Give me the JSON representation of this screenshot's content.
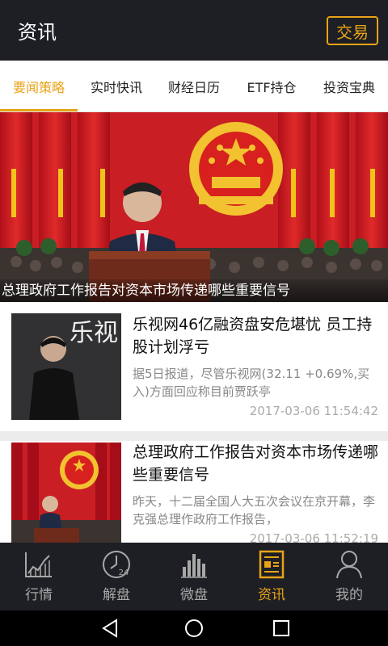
{
  "header": {
    "title": "资讯",
    "trade_button": "交易"
  },
  "tabs": [
    {
      "label": "要闻策略",
      "active": true
    },
    {
      "label": "实时快讯",
      "active": false
    },
    {
      "label": "财经日历",
      "active": false
    },
    {
      "label": "ETF持仓",
      "active": false
    },
    {
      "label": "投资宝典",
      "active": false
    }
  ],
  "banner": {
    "caption": "总理政府工作报告对资本市场传递哪些重要信号"
  },
  "news": [
    {
      "headline": "乐视网46亿融资盘安危堪忧 员工持股计划浮亏",
      "summary": "据5日报道，尽管乐视网(32.11 +0.69%,买入)方面回应称目前贾跃亭",
      "time": "2017-03-06 11:54:42",
      "thumb_text": "乐视"
    },
    {
      "headline": "总理政府工作报告对资本市场传递哪些重要信号",
      "summary": "昨天，十二届全国人大五次会议在京开幕，李克强总理作政府工作报告，",
      "time": "2017-03-06 11:52:19"
    }
  ],
  "bottom_nav": [
    {
      "label": "行情",
      "icon": "chart-icon",
      "active": false
    },
    {
      "label": "解盘",
      "icon": "clock-24-icon",
      "active": false
    },
    {
      "label": "微盘",
      "icon": "bars-icon",
      "active": false
    },
    {
      "label": "资讯",
      "icon": "news-icon",
      "active": true
    },
    {
      "label": "我的",
      "icon": "user-icon",
      "active": false
    }
  ],
  "colors": {
    "accent": "#e8a317",
    "header_bg": "#1e1f24"
  }
}
